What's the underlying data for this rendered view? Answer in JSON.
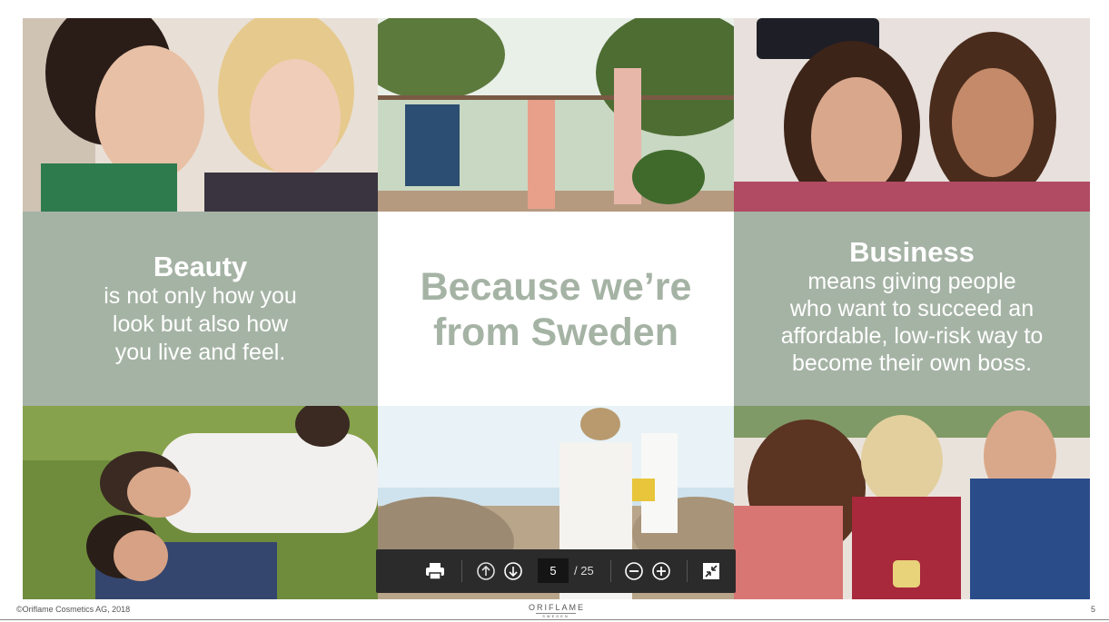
{
  "beauty": {
    "heading": "Beauty",
    "line1": "is not only how you",
    "line2": "look but also how",
    "line3": "you live and feel."
  },
  "center": {
    "line1": "Because we’re",
    "line2": "from Sweden"
  },
  "business": {
    "heading": "Business",
    "line1": "means giving people",
    "line2": "who want to succeed an",
    "line3": "affordable, low-risk way to",
    "line4": "become their own boss."
  },
  "footer": {
    "copyright": "©Oriflame Cosmetics AG, 2018",
    "logo_main": "ORIFLAME",
    "logo_sub": "SWEDEN",
    "page_number": "5"
  },
  "toolbar": {
    "current_page": "5",
    "total_label": "/ 25",
    "icons": [
      "print-icon",
      "page-up-icon",
      "page-down-icon",
      "zoom-out-icon",
      "zoom-in-icon",
      "fullscreen-exit-icon"
    ]
  },
  "colors": {
    "sage": "#a5b3a5",
    "toolbar_bg": "#2b2b2b"
  }
}
